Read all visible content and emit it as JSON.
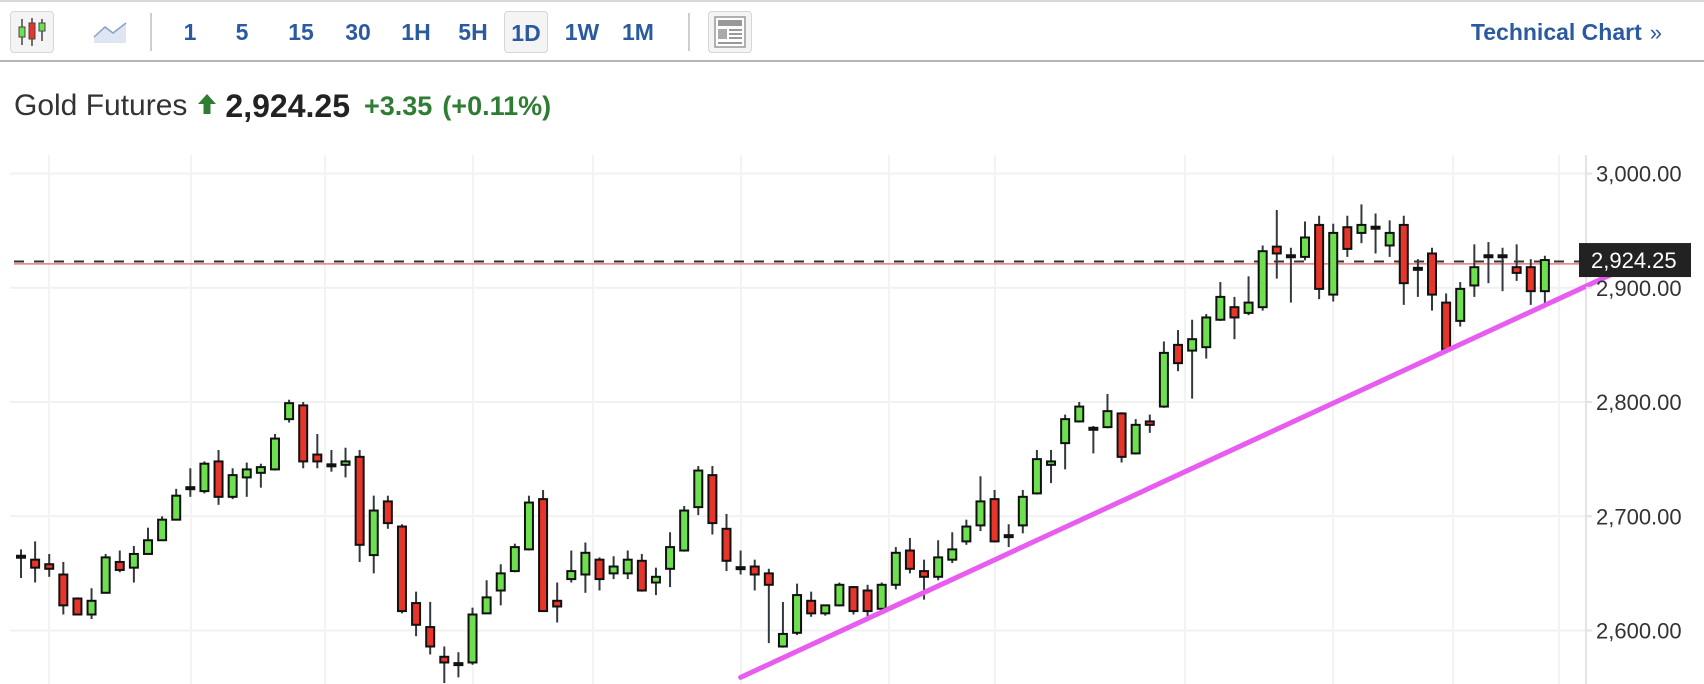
{
  "toolbar": {
    "chart_types": [
      {
        "name": "candlestick",
        "icon": "candlestick-icon",
        "active": true
      },
      {
        "name": "area",
        "icon": "area-chart-icon",
        "active": false
      }
    ],
    "timeframes": [
      {
        "label": "1",
        "active": false
      },
      {
        "label": "5",
        "active": false
      },
      {
        "label": "15",
        "active": false
      },
      {
        "label": "30",
        "active": false
      },
      {
        "label": "1H",
        "active": false
      },
      {
        "label": "5H",
        "active": false
      },
      {
        "label": "1D",
        "active": true
      },
      {
        "label": "1W",
        "active": false
      },
      {
        "label": "1M",
        "active": false
      }
    ],
    "layout_icon": "layout-panel-icon",
    "technical_chart_label": "Technical Chart",
    "technical_chart_chevron": "»"
  },
  "quote": {
    "name": "Gold Futures",
    "direction": "up",
    "price": "2,924.25",
    "change": "+3.35",
    "change_pct": "(+0.11%)"
  },
  "colors": {
    "up": "#6ee04f",
    "down": "#e8352a",
    "outline": "#111111",
    "wick": "#333a3f",
    "trendline": "#e85cf0",
    "last_price_line": "#333333",
    "prev_close_line": "#e87a7a",
    "link": "#2b5aa0",
    "positive": "#2e7d32",
    "label_bg": "#222222"
  },
  "chart_data": {
    "type": "candlestick",
    "title": "Gold Futures",
    "interval": "1D",
    "xlabel": "",
    "ylabel": "",
    "ylim": [
      2549,
      3012
    ],
    "yticks": [
      3000,
      2900,
      2800,
      2700,
      2600
    ],
    "ytick_labels": [
      "3,000.00",
      "2,900.00",
      "2,800.00",
      "2,700.00",
      "2,600.00"
    ],
    "grid": true,
    "last_price": 2924.25,
    "last_price_label": "2,924.25",
    "prev_close": 2920.9,
    "candles_ohlc": [
      [
        2664,
        2671,
        2646,
        2665
      ],
      [
        2662,
        2678,
        2642,
        2655
      ],
      [
        2658,
        2667,
        2647,
        2654
      ],
      [
        2649,
        2660,
        2614,
        2622
      ],
      [
        2628,
        2629,
        2614,
        2614
      ],
      [
        2614,
        2637,
        2610,
        2626
      ],
      [
        2633,
        2667,
        2633,
        2664
      ],
      [
        2660,
        2670,
        2651,
        2653
      ],
      [
        2655,
        2674,
        2642,
        2667
      ],
      [
        2667,
        2690,
        2667,
        2679
      ],
      [
        2679,
        2700,
        2679,
        2697
      ],
      [
        2697,
        2724,
        2697,
        2718
      ],
      [
        2724,
        2742,
        2717,
        2725
      ],
      [
        2722,
        2748,
        2720,
        2746
      ],
      [
        2748,
        2758,
        2710,
        2717
      ],
      [
        2717,
        2742,
        2715,
        2736
      ],
      [
        2734,
        2747,
        2717,
        2741
      ],
      [
        2738,
        2746,
        2725,
        2743
      ],
      [
        2741,
        2772,
        2740,
        2768
      ],
      [
        2785,
        2802,
        2782,
        2799
      ],
      [
        2797,
        2800,
        2742,
        2748
      ],
      [
        2754,
        2772,
        2742,
        2748
      ],
      [
        2744,
        2758,
        2739,
        2745
      ],
      [
        2745,
        2760,
        2734,
        2748
      ],
      [
        2752,
        2758,
        2660,
        2675
      ],
      [
        2666,
        2718,
        2650,
        2705
      ],
      [
        2713,
        2718,
        2689,
        2694
      ],
      [
        2691,
        2693,
        2615,
        2617
      ],
      [
        2624,
        2634,
        2595,
        2605
      ],
      [
        2603,
        2625,
        2579,
        2586
      ],
      [
        2577,
        2586,
        2554,
        2572
      ],
      [
        2570,
        2581,
        2559,
        2571
      ],
      [
        2572,
        2620,
        2570,
        2614
      ],
      [
        2615,
        2644,
        2615,
        2629
      ],
      [
        2635,
        2658,
        2622,
        2650
      ],
      [
        2652,
        2676,
        2651,
        2673
      ],
      [
        2671,
        2718,
        2670,
        2712
      ],
      [
        2715,
        2723,
        2617,
        2617
      ],
      [
        2626,
        2642,
        2607,
        2621
      ],
      [
        2645,
        2670,
        2642,
        2652
      ],
      [
        2649,
        2677,
        2633,
        2668
      ],
      [
        2662,
        2664,
        2635,
        2645
      ],
      [
        2650,
        2665,
        2645,
        2656
      ],
      [
        2650,
        2670,
        2645,
        2662
      ],
      [
        2661,
        2667,
        2634,
        2635
      ],
      [
        2642,
        2655,
        2631,
        2647
      ],
      [
        2654,
        2686,
        2638,
        2673
      ],
      [
        2670,
        2709,
        2669,
        2705
      ],
      [
        2708,
        2744,
        2701,
        2740
      ],
      [
        2736,
        2744,
        2684,
        2694
      ],
      [
        2689,
        2702,
        2652,
        2661
      ],
      [
        2655,
        2670,
        2649,
        2654
      ],
      [
        2656,
        2662,
        2635,
        2649
      ],
      [
        2650,
        2654,
        2589,
        2640
      ],
      [
        2586,
        2625,
        2585,
        2597
      ],
      [
        2598,
        2641,
        2596,
        2631
      ],
      [
        2626,
        2634,
        2612,
        2615
      ],
      [
        2615,
        2622,
        2613,
        2622
      ],
      [
        2622,
        2642,
        2621,
        2640
      ],
      [
        2638,
        2639,
        2614,
        2617
      ],
      [
        2635,
        2640,
        2612,
        2617
      ],
      [
        2619,
        2642,
        2618,
        2640
      ],
      [
        2640,
        2673,
        2636,
        2668
      ],
      [
        2670,
        2681,
        2650,
        2654
      ],
      [
        2652,
        2662,
        2627,
        2647
      ],
      [
        2647,
        2679,
        2644,
        2664
      ],
      [
        2662,
        2686,
        2659,
        2671
      ],
      [
        2678,
        2697,
        2675,
        2691
      ],
      [
        2692,
        2735,
        2687,
        2713
      ],
      [
        2715,
        2723,
        2677,
        2678
      ],
      [
        2682,
        2693,
        2673,
        2683
      ],
      [
        2692,
        2723,
        2685,
        2717
      ],
      [
        2720,
        2758,
        2719,
        2750
      ],
      [
        2745,
        2758,
        2729,
        2748
      ],
      [
        2764,
        2789,
        2741,
        2785
      ],
      [
        2783,
        2800,
        2782,
        2796
      ],
      [
        2776,
        2779,
        2755,
        2777
      ],
      [
        2778,
        2807,
        2777,
        2792
      ],
      [
        2790,
        2791,
        2747,
        2752
      ],
      [
        2755,
        2785,
        2754,
        2780
      ],
      [
        2783,
        2789,
        2773,
        2780
      ],
      [
        2796,
        2853,
        2795,
        2843
      ],
      [
        2850,
        2863,
        2827,
        2834
      ],
      [
        2845,
        2872,
        2803,
        2855
      ],
      [
        2848,
        2877,
        2838,
        2874
      ],
      [
        2872,
        2905,
        2871,
        2892
      ],
      [
        2883,
        2892,
        2855,
        2874
      ],
      [
        2878,
        2910,
        2876,
        2887
      ],
      [
        2883,
        2937,
        2880,
        2932
      ],
      [
        2936,
        2968,
        2908,
        2930
      ],
      [
        2927,
        2935,
        2887,
        2928
      ],
      [
        2927,
        2958,
        2924,
        2944
      ],
      [
        2955,
        2963,
        2890,
        2899
      ],
      [
        2894,
        2956,
        2888,
        2948
      ],
      [
        2953,
        2963,
        2927,
        2934
      ],
      [
        2948,
        2973,
        2939,
        2955
      ],
      [
        2952,
        2965,
        2930,
        2953
      ],
      [
        2937,
        2959,
        2927,
        2948
      ],
      [
        2955,
        2963,
        2885,
        2904
      ],
      [
        2916,
        2925,
        2892,
        2917
      ],
      [
        2930,
        2935,
        2880,
        2894
      ],
      [
        2887,
        2895,
        2845,
        2846
      ],
      [
        2871,
        2905,
        2866,
        2899
      ],
      [
        2902,
        2938,
        2892,
        2918
      ],
      [
        2927,
        2940,
        2904,
        2928
      ],
      [
        2927,
        2935,
        2897,
        2928
      ],
      [
        2918,
        2938,
        2906,
        2913
      ],
      [
        2918,
        2925,
        2885,
        2897
      ],
      [
        2897,
        2928,
        2884,
        2924.25
      ]
    ],
    "trendline": {
      "from": {
        "index": 52,
        "price": 2559
      },
      "to": {
        "index": 113.6,
        "price": 2911
      }
    }
  }
}
